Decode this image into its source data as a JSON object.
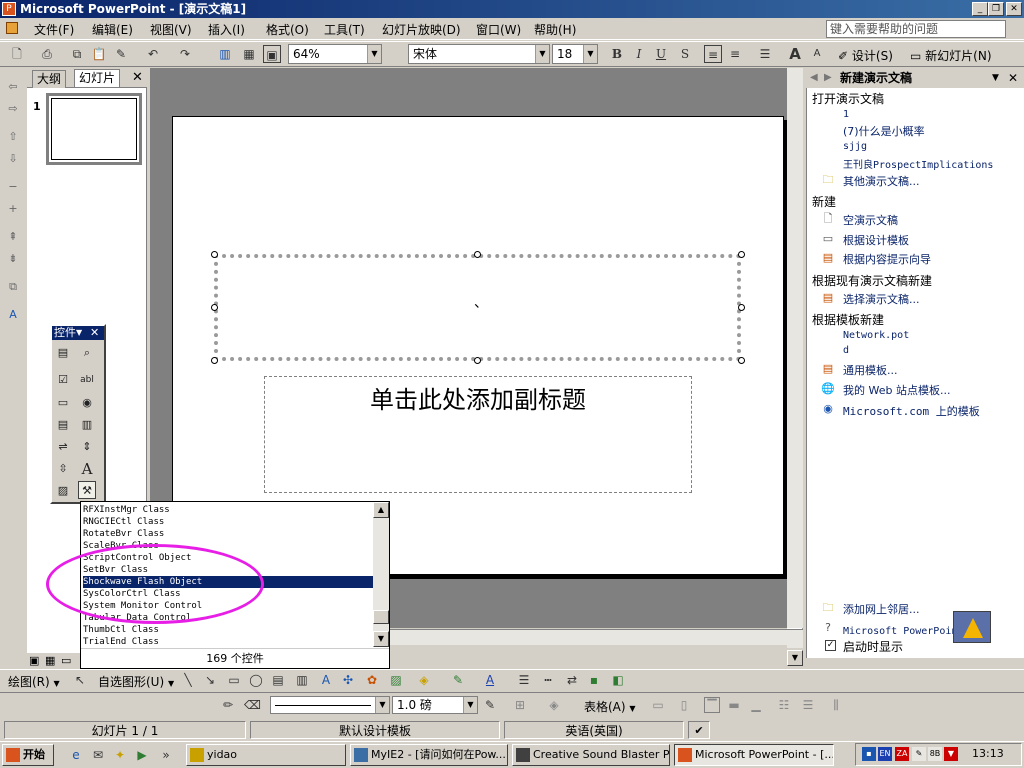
{
  "window": {
    "title": "Microsoft PowerPoint - [演示文稿1]",
    "icon": "powerpoint-icon"
  },
  "menu": [
    "文件(F)",
    "编辑(E)",
    "视图(V)",
    "插入(I)",
    "格式(O)",
    "工具(T)",
    "幻灯片放映(D)",
    "窗口(W)",
    "帮助(H)"
  ],
  "help_box": {
    "placeholder": "键入需要帮助的问题"
  },
  "toolbar": {
    "zoom": "64%",
    "font": "宋体",
    "font_size": "18",
    "design_label": "设计(S)",
    "new_slide_label": "新幻灯片(N)"
  },
  "left_pane": {
    "tabs": [
      "大纲",
      "幻灯片"
    ],
    "slide_number": "1"
  },
  "slide": {
    "subtitle_placeholder": "单击此处添加副标题",
    "title_text": "、"
  },
  "controls_toolbar": {
    "title": "控件"
  },
  "control_list": {
    "items": [
      "RFXInstMgr Class",
      "RNGCIECtl Class",
      "RotateBvr Class",
      "ScaleBvr Class",
      "ScriptControl Object",
      "SetBvr Class",
      "Shockwave Flash Object",
      "SysColorCtrl Class",
      "System Monitor Control",
      "Tabular Data Control",
      "ThumbCtl Class",
      "TrialEnd Class"
    ],
    "selected_index": 6,
    "count_label": "169 个控件"
  },
  "task_pane": {
    "title": "新建演示文稿",
    "open_section": "打开演示文稿",
    "recent_files": [
      "1",
      "(7)什么是小概率",
      "sjjg",
      "王刊良ProspectImplications"
    ],
    "other_files": "其他演示文稿...",
    "new_section": "新建",
    "new_items": [
      "空演示文稿",
      "根据设计模板",
      "根据内容提示向导"
    ],
    "from_existing_section": "根据现有演示文稿新建",
    "from_existing_item": "选择演示文稿...",
    "from_template_section": "根据模板新建",
    "template_files": [
      "Network.pot",
      "d"
    ],
    "template_items": [
      "通用模板...",
      "我的 Web 站点模板...",
      "Microsoft.com 上的模板"
    ],
    "add_network_place": "添加网上邻居...",
    "help_link": "Microsoft PowerPoint 帮助",
    "show_at_startup": "启动时显示"
  },
  "drawing_toolbar": {
    "draw_label": "绘图(R)",
    "autoshapes_label": "自选图形(U)"
  },
  "format_toolbar": {
    "line_weight": "1.0 磅",
    "table_label": "表格(A)"
  },
  "status_bar": {
    "slide_info": "幻灯片 1 / 1",
    "design": "默认设计模板",
    "language": "英语(英国)"
  },
  "taskbar": {
    "start": "开始",
    "items": [
      "yidao",
      "MyIE2 - [请问如何在Pow...",
      "Creative Sound Blaster P...",
      "Microsoft PowerPoint - [..."
    ],
    "clock": "13:13",
    "tray": [
      "EN",
      "ZA",
      "8B"
    ]
  }
}
